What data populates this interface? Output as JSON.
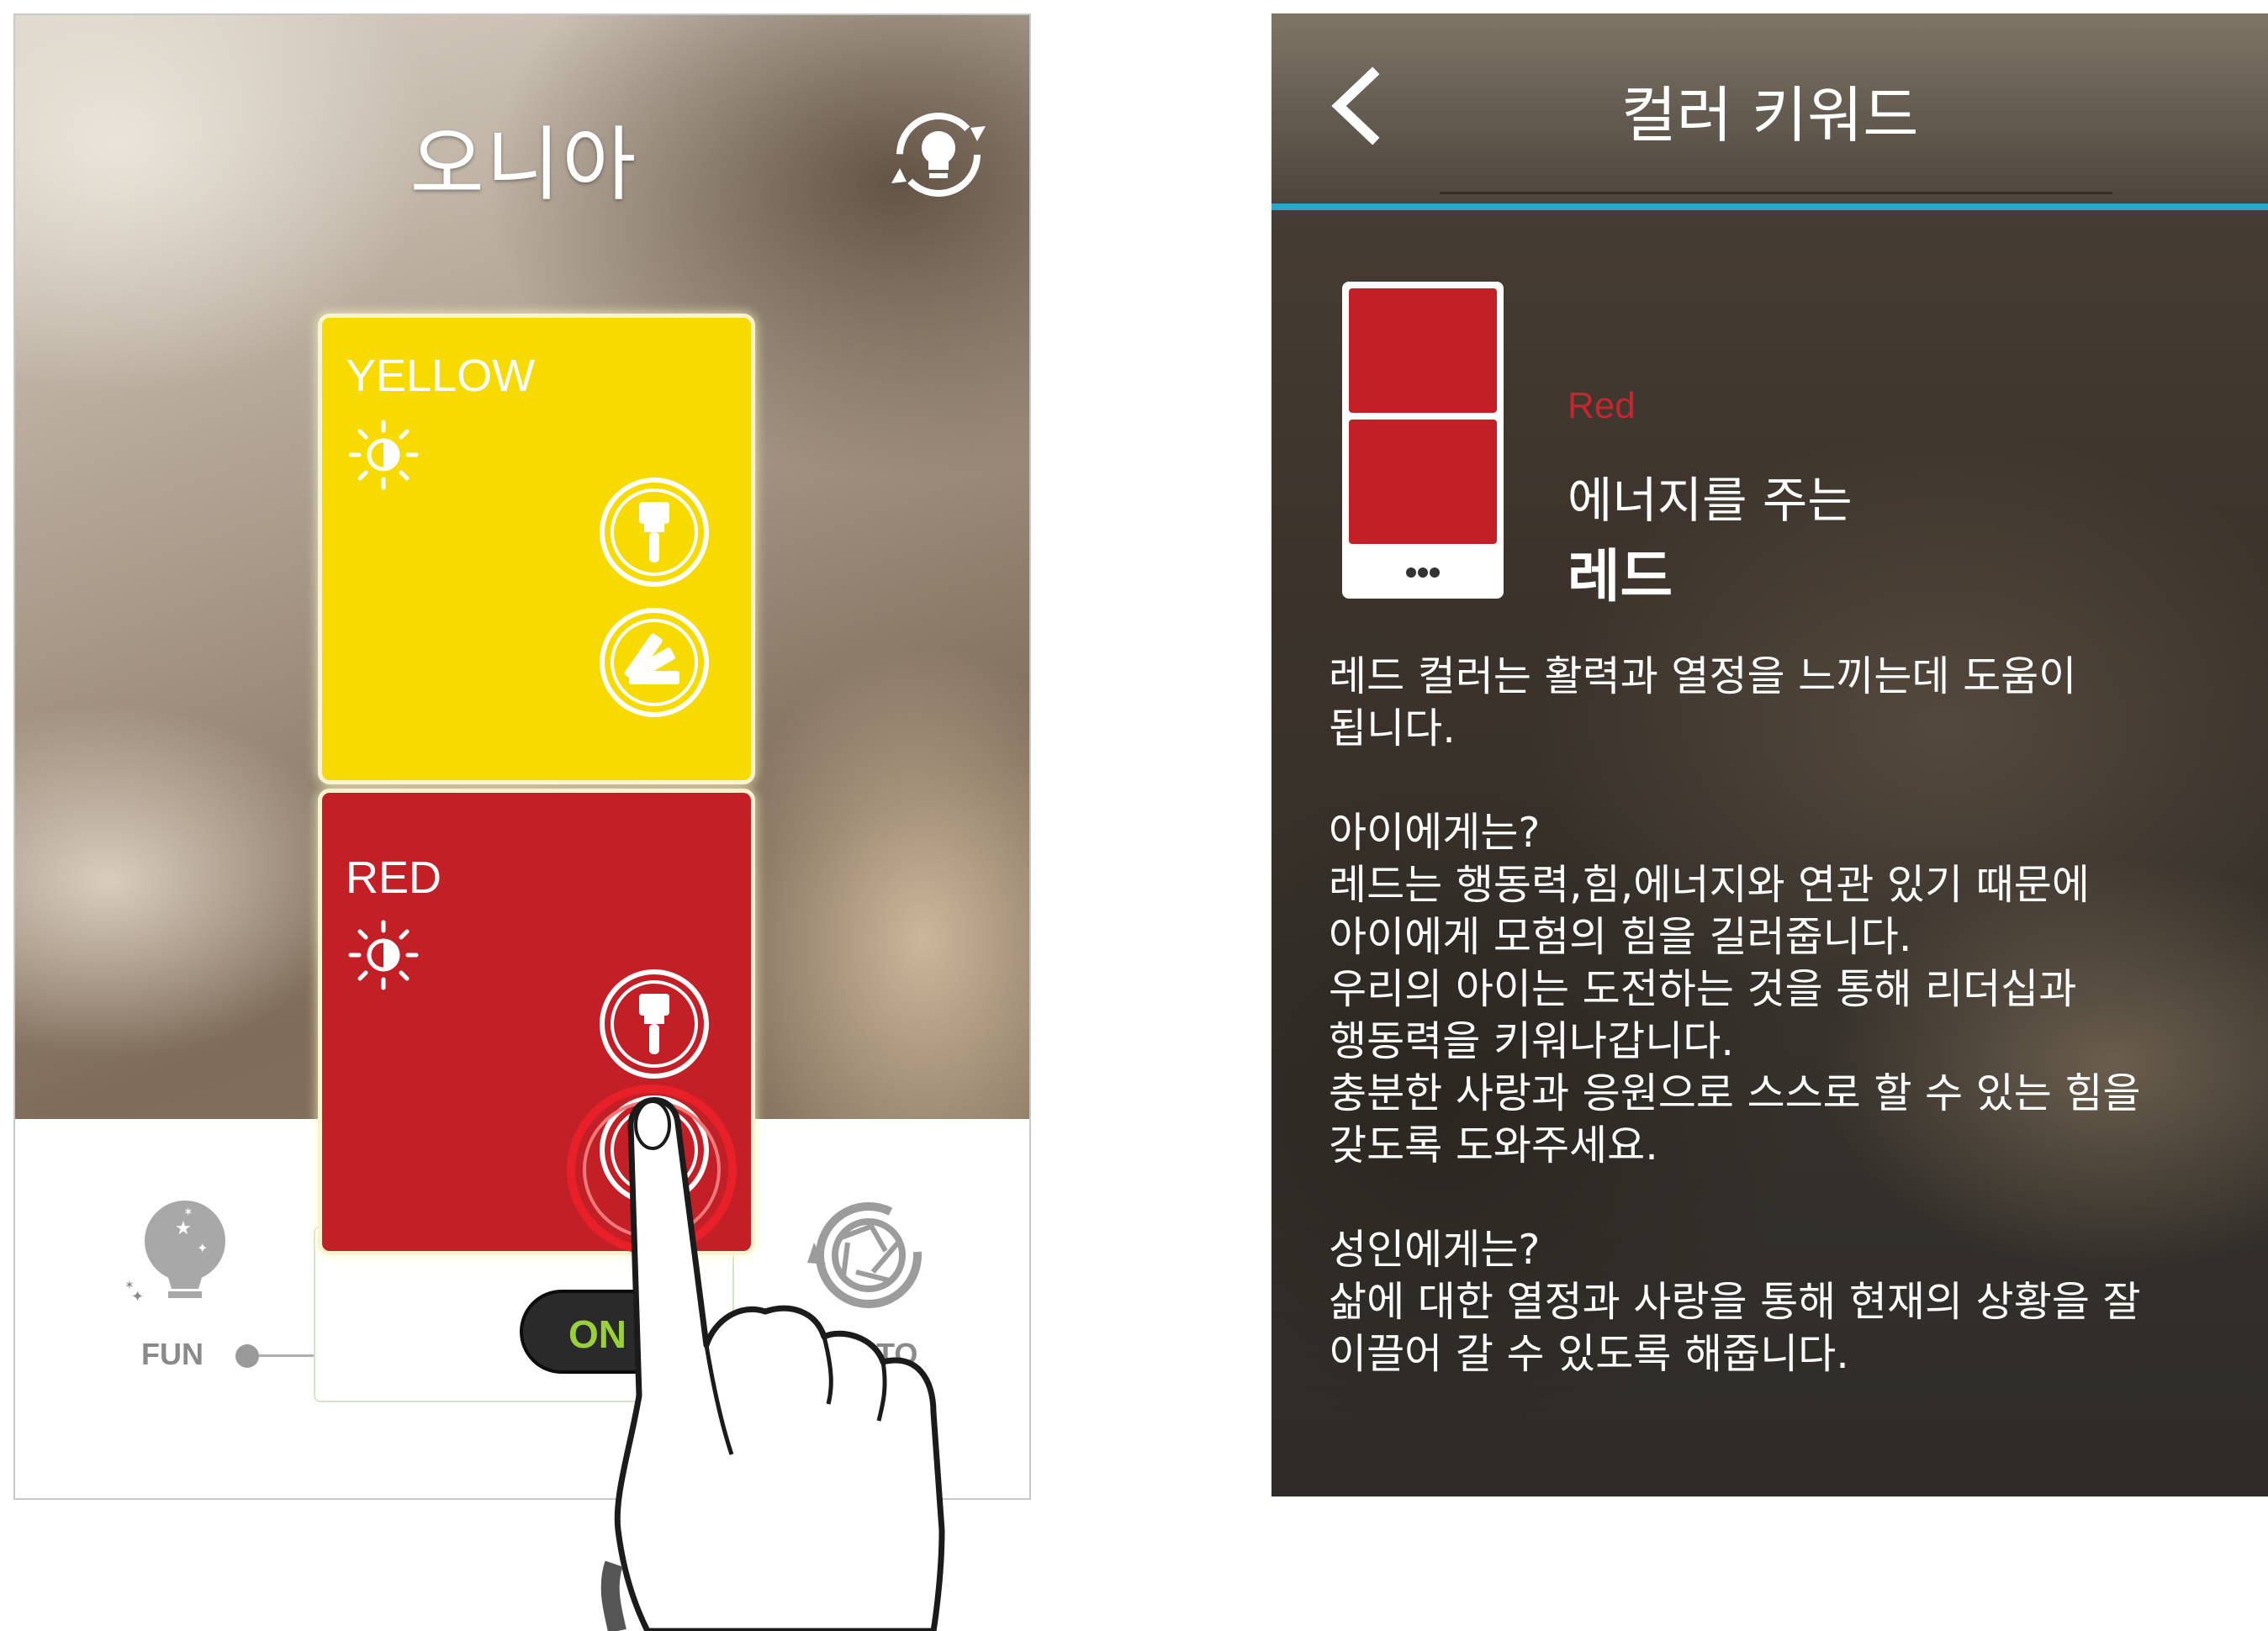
{
  "left_screen": {
    "title": "오니아",
    "cards": [
      {
        "name": "YELLOW",
        "color": "#f6da00"
      },
      {
        "name": "RED",
        "color": "#c31f26"
      }
    ],
    "modes": {
      "fun": "FUN",
      "auto": "AUTO"
    },
    "power_toggle": {
      "label": "ON",
      "state": "on"
    }
  },
  "right_screen": {
    "header_title": "컬러 키워드",
    "color_name": "Red",
    "tagline": "에너지를 주는",
    "color_korean": "레드",
    "description": {
      "intro": [
        "레드 컬러는 활력과 열정을 느끼는데 도움이",
        "됩니다."
      ],
      "child_heading": "아이에게는?",
      "child_lines": [
        "레드는 행동력,힘,에너지와 연관 있기 때문에",
        "아이에게 모험의 힘을 길러줍니다.",
        "우리의 아이는 도전하는 것을 통해 리더십과",
        "행동력을 키워나갑니다.",
        "충분한 사랑과 응원으로 스스로 할 수 있는 힘을",
        "갖도록 도와주세요."
      ],
      "adult_heading": "성인에게는?",
      "adult_lines": [
        "삶에 대한 열정과 사랑을 통해 현재의 상황을 잘",
        "이끌어 갈 수 있도록 해줍니다."
      ]
    },
    "accent_color": "#2aa6cf"
  }
}
